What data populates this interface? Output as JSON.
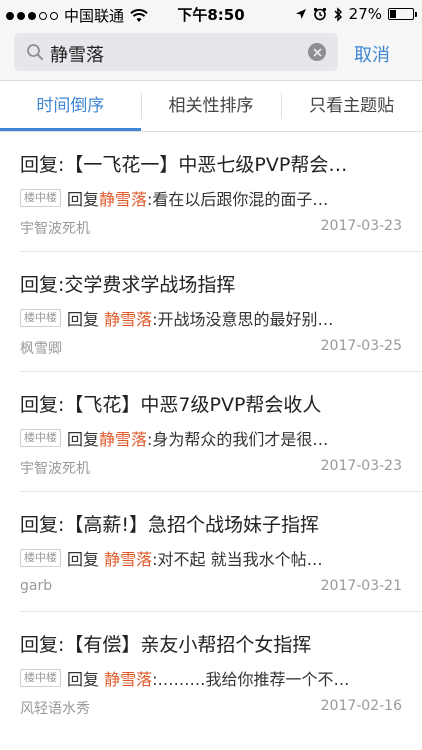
{
  "status_bar": {
    "carrier": "中国联通",
    "time": "下午8:50",
    "battery_percent": "27%",
    "battery_level": 0.27,
    "signal_bars_filled": 3,
    "signal_bars_total": 5
  },
  "search": {
    "query": "静雪落",
    "cancel_label": "取消"
  },
  "tabs": [
    {
      "label": "时间倒序",
      "active": true
    },
    {
      "label": "相关性排序",
      "active": false
    },
    {
      "label": "只看主题贴",
      "active": false
    }
  ],
  "colors": {
    "accent": "#3f87d6",
    "highlight": "#e05a2b"
  },
  "results": [
    {
      "title": "回复:【一飞花一】中恶七级PVP帮会…",
      "floor_badge": "楼中楼",
      "reply_prefix": "回复",
      "reply_to": "静雪落",
      "snippet": ":看在以后跟你混的面子…",
      "author": "宇智波死机",
      "date": "2017-03-23"
    },
    {
      "title": "回复:交学费求学战场指挥",
      "floor_badge": "楼中楼",
      "reply_prefix": "回复 ",
      "reply_to": "静雪落",
      "snippet": ":开战场没意思的最好别…",
      "author": "枫雪卿",
      "date": "2017-03-25"
    },
    {
      "title": "回复:【飞花】中恶7级PVP帮会收人",
      "floor_badge": "楼中楼",
      "reply_prefix": "回复",
      "reply_to": "静雪落",
      "snippet": ":身为帮众的我们才是很…",
      "author": "宇智波死机",
      "date": "2017-03-23"
    },
    {
      "title": "回复:【高薪!】急招个战场妹子指挥",
      "floor_badge": "楼中楼",
      "reply_prefix": "回复 ",
      "reply_to": "静雪落",
      "snippet": ":对不起 就当我水个帖…",
      "author": "garb",
      "date": "2017-03-21"
    },
    {
      "title": "回复:【有偿】亲友小帮招个女指挥",
      "floor_badge": "楼中楼",
      "reply_prefix": "回复 ",
      "reply_to": "静雪落",
      "snippet": ":………我给你推荐一个不…",
      "author": "风轻语水秀",
      "date": "2017-02-16"
    }
  ]
}
